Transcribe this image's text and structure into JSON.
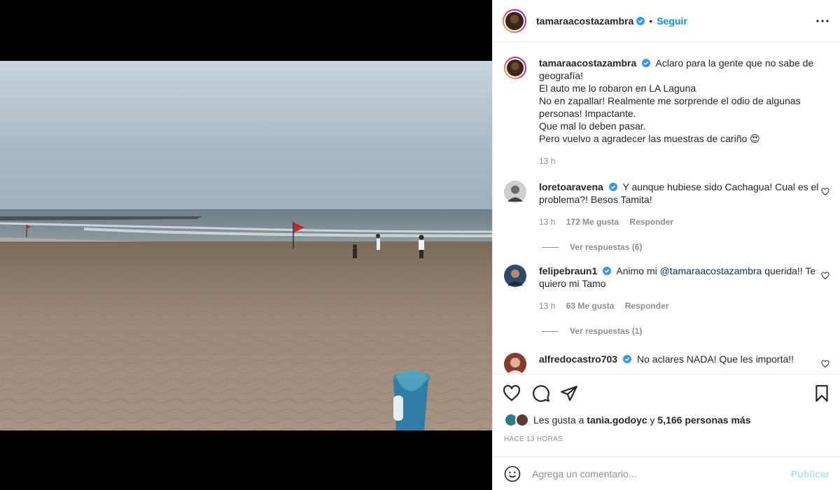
{
  "header": {
    "username": "tamaraacostazambra",
    "separator": "•",
    "follow_label": "Seguir",
    "more_icon": "more-horizontal-icon"
  },
  "caption": {
    "username": "tamaraacostazambra",
    "lines": [
      "Aclaro para la gente que no sabe de geografía!",
      "El auto me lo robaron en LA Laguna",
      "No en zapallar! Realmente me sorprende el odio de algunas personas! Impactante.",
      "Que mal lo deben pasar.",
      "Pero vuelvo a agradecer las muestras de cariño 😍"
    ],
    "time": "13 h"
  },
  "comments": [
    {
      "username": "loretoaravena",
      "text": "Y aunque hubiese sido Cachagua! Cual es el problema?! Besos Tamita!",
      "time": "13 h",
      "likes": "172 Me gusta",
      "reply_label": "Responder",
      "view_replies": "Ver respuestas (6)"
    },
    {
      "username": "felipebraun1",
      "text_before": "Animo mi ",
      "mention": "@tamaraacostazambra",
      "text_after": " querida!! Te quiero mi Tamo",
      "time": "13 h",
      "likes": "63 Me gusta",
      "reply_label": "Responder",
      "view_replies": "Ver respuestas (1)"
    },
    {
      "username": "alfredocastro703",
      "text": "No aclares NADA! Que les importa!!"
    }
  ],
  "likes": {
    "prefix": "Les gusta a",
    "user": "tania.godoyc",
    "conjunction": "y",
    "others": "5,166 personas más"
  },
  "posted_ago": "HACE 13 HORAS",
  "add_comment": {
    "placeholder": "Agrega un comentario...",
    "publish_label": "Publicar"
  },
  "colors": {
    "accent": "#0095f6",
    "verified": "#3897f0",
    "muted": "#8e8e8e",
    "publish_disabled": "#b2dffc"
  }
}
